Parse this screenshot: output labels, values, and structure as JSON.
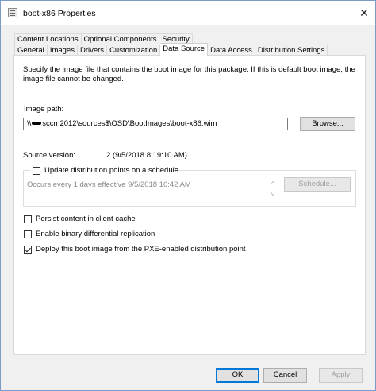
{
  "window": {
    "title": "boot-x86 Properties",
    "close_glyph": "✕"
  },
  "tabs": {
    "row1": [
      "Content Locations",
      "Optional Components",
      "Security"
    ],
    "row2": [
      "General",
      "Images",
      "Drivers",
      "Customization",
      "Data Source",
      "Data Access",
      "Distribution Settings"
    ],
    "active": "Data Source"
  },
  "data_source": {
    "description": "Specify the image file that contains the boot image for this package. If this is default boot image, the image file cannot be changed.",
    "image_path_label": "Image path:",
    "image_path_prefix": "\\\\",
    "image_path_suffix": "sccm2012\\sources$\\OSD\\BootImages\\boot-x86.wim",
    "browse_label": "Browse...",
    "source_version_label": "Source version:",
    "source_version_value": "2 (9/5/2018 8:19:10 AM)",
    "schedule_checkbox_label": "Update distribution points on a schedule",
    "schedule_checked": false,
    "schedule_text": "Occurs every 1 days effective 9/5/2018 10:42 AM",
    "schedule_button_label": "Schedule...",
    "persist_label": "Persist content in client cache",
    "persist_checked": false,
    "binary_label": "Enable binary differential replication",
    "binary_checked": false,
    "deploy_label": "Deploy this boot image from the PXE-enabled distribution point",
    "deploy_checked": true
  },
  "buttons": {
    "ok": "OK",
    "cancel": "Cancel",
    "apply": "Apply"
  },
  "icons": {
    "scroll_up": "^",
    "scroll_down": "v"
  }
}
